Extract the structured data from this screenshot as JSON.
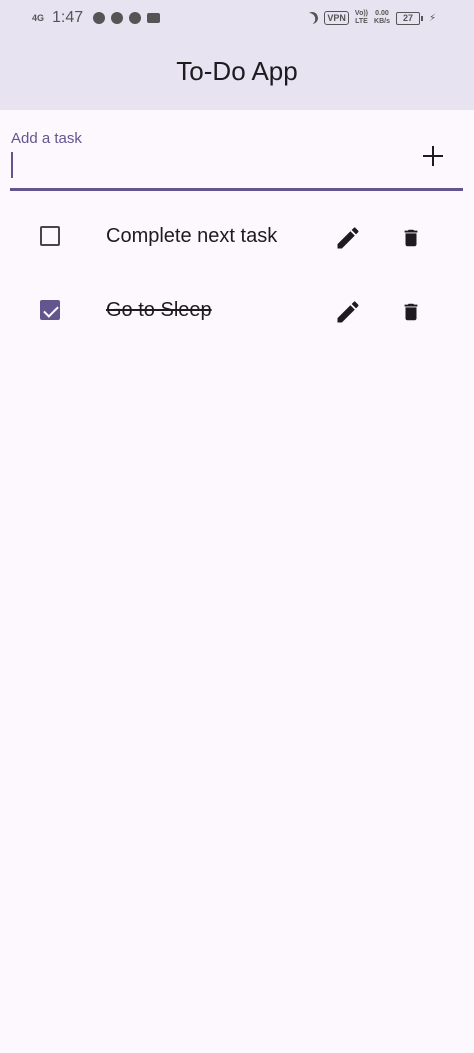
{
  "status_bar": {
    "network": "4G",
    "time": "1:47",
    "vpn": "VPN",
    "volte_top": "Vo))",
    "volte_bottom": "LTE",
    "speed_value": "0.00",
    "speed_unit": "KB/s",
    "battery": "27"
  },
  "app_bar": {
    "title": "To-Do App"
  },
  "task_input": {
    "label": "Add a task",
    "value": ""
  },
  "tasks": [
    {
      "text": "Complete next task",
      "done": false
    },
    {
      "text": "Go to Sleep",
      "done": true
    }
  ],
  "colors": {
    "accent": "#65558f",
    "background": "#fdf7fe",
    "appbar": "#e8e3f0"
  }
}
